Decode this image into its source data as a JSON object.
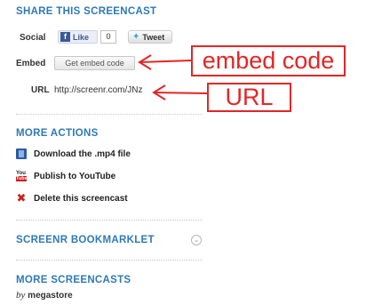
{
  "share": {
    "title": "SHARE THIS SCREENCAST",
    "social_label": "Social",
    "like_label": "Like",
    "like_count": "0",
    "tweet_label": "Tweet",
    "embed_label": "Embed",
    "embed_button": "Get embed code",
    "url_label": "URL",
    "url_value": "http://screenr.com/JNz"
  },
  "more_actions": {
    "title": "MORE ACTIONS",
    "items": [
      {
        "label": "Download the .mp4 file",
        "icon": "download-icon"
      },
      {
        "label": "Publish to YouTube",
        "icon": "youtube-icon"
      },
      {
        "label": "Delete this screencast",
        "icon": "delete-icon"
      }
    ]
  },
  "bookmarklet": {
    "title": "SCREENR BOOKMARKLET"
  },
  "more_screencasts": {
    "title": "MORE SCREENCASTS",
    "by": "by",
    "user": "megastore"
  },
  "annotations": {
    "embed_callout": "embed code",
    "url_callout": "URL"
  },
  "colors": {
    "accent": "#2f7ab5",
    "annotation": "#e32626"
  }
}
